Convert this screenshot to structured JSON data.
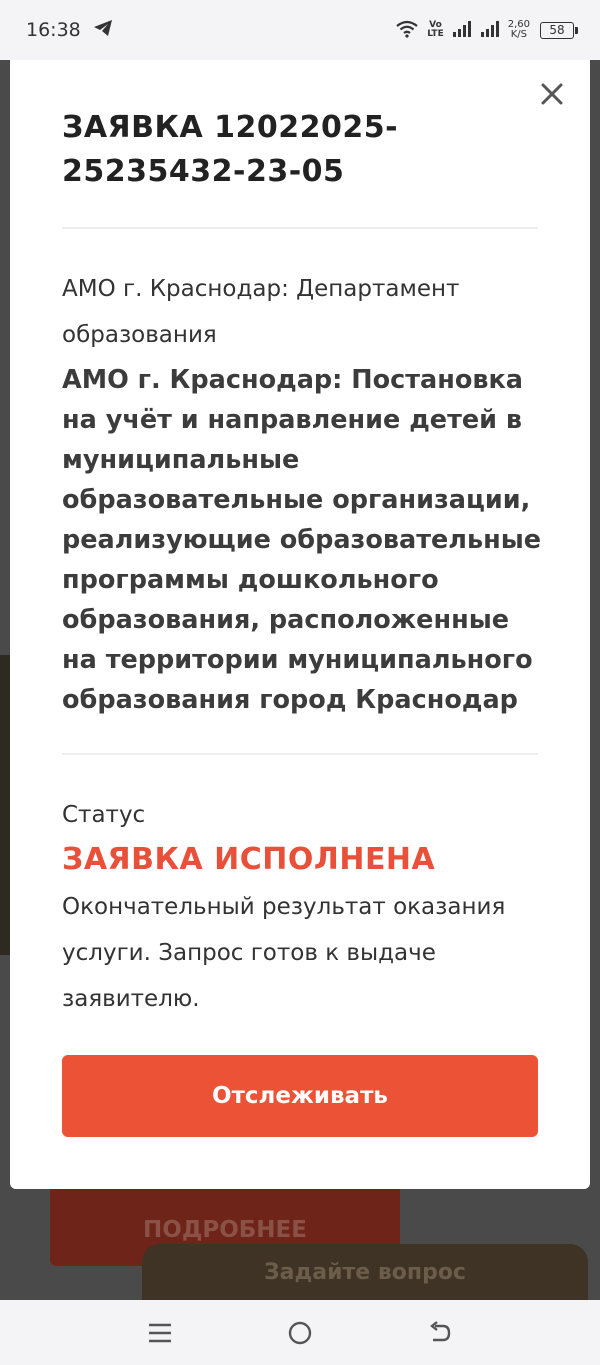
{
  "status_bar": {
    "time": "16:38",
    "volte_top": "Vo",
    "volte_bottom": "LTE",
    "net_speed_value": "2,60",
    "net_speed_unit": "K/S",
    "battery": "58"
  },
  "modal": {
    "title": "ЗАЯВКА 12022025-25235432-23-05",
    "department": "АМО г. Краснодар: Департамент образования",
    "service": "АМО г. Краснодар: Постановка на учёт и направление детей в муниципальные образовательные организации, реализующие образовательные программы дошкольного образования, расположенные на территории муниципального образования город Краснодар",
    "status_label": "Статус",
    "status_value": "ЗАЯВКА ИСПОЛНЕНА",
    "status_description": "Окончательный результат оказания услуги. Запрос готов к выдаче заявителю.",
    "track_button": "Отслеживать"
  },
  "background": {
    "more_button": "ПОДРОБНЕЕ",
    "ask_button": "Задайте вопрос"
  },
  "colors": {
    "accent": "#ec5236",
    "status": "#e8503a"
  },
  "icons": {
    "close": "close-icon",
    "telegram": "telegram-icon",
    "wifi": "wifi-icon",
    "signal": "signal-icon",
    "nav_menu": "menu-icon",
    "nav_home": "home-icon",
    "nav_back": "back-icon"
  }
}
